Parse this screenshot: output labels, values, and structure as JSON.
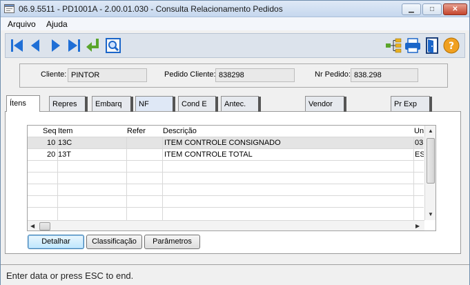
{
  "window": {
    "title": "06.9.5511 - PD1001A - 2.00.01.030 - Consulta Relacionamento Pedidos",
    "minimize_label": "▁",
    "maximize_label": "□",
    "close_label": "✕"
  },
  "menu": {
    "items": [
      {
        "label": "Arquivo"
      },
      {
        "label": "Ajuda"
      }
    ]
  },
  "toolbar": {
    "icons": [
      "first-record-icon",
      "previous-record-icon",
      "next-record-icon",
      "last-record-icon",
      "return-icon",
      "zoom-search-icon",
      "hierarchy-icon",
      "print-icon",
      "exit-door-icon",
      "help-icon"
    ],
    "colors": {
      "nav": "#1f6fd6",
      "return": "#5aa52c",
      "help": "#f0a020",
      "print": "#1b66c9"
    }
  },
  "header": {
    "cliente_label": "Cliente:",
    "cliente_value": "PINTOR",
    "pedido_cliente_label": "Pedido Cliente:",
    "pedido_cliente_value": "838298",
    "nr_pedido_label": "Nr Pedido:",
    "nr_pedido_value": "838.298"
  },
  "tabs": [
    {
      "label": "Ítens"
    },
    {
      "label": "Repres"
    },
    {
      "label": "Embarq"
    },
    {
      "label": "NF"
    },
    {
      "label": "Cond E"
    },
    {
      "label": "Antec."
    },
    {
      "label": "Vendor"
    },
    {
      "label": "Pr Exp"
    }
  ],
  "grid": {
    "columns": [
      "Seq",
      "Item",
      "Refer",
      "Descrição",
      "Uni"
    ],
    "rows": [
      {
        "seq": "10",
        "item": "13C",
        "refer": "",
        "descricao": "ITEM CONTROLE CONSIGNADO",
        "uni": "03"
      },
      {
        "seq": "20",
        "item": "13T",
        "refer": "",
        "descricao": "ITEM CONTROLE TOTAL",
        "uni": "ES"
      }
    ]
  },
  "buttons": {
    "detalhar": "Detalhar",
    "classificacao": "Classificação",
    "parametros": "Parâmetros"
  },
  "status": {
    "text": "Enter data or press ESC to end."
  }
}
